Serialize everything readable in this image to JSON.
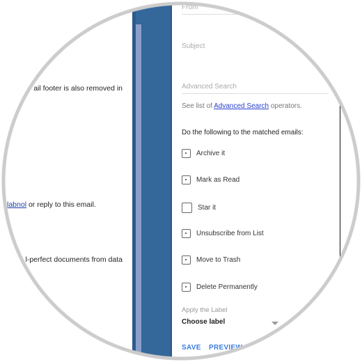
{
  "email": {
    "line1": "ail footer is also removed in",
    "line2_link": "labnol",
    "line2_rest": " or reply to this email.",
    "line3": "l-perfect documents from data"
  },
  "filter": {
    "from_placeholder": "From",
    "subject_placeholder": "Subject",
    "advanced_placeholder": "Advanced Search",
    "hint_prefix": "See list of ",
    "hint_link": "Advanced Search",
    "hint_suffix": " operators.",
    "actions_heading": "Do the following to the matched emails:",
    "options": [
      {
        "label": "Archive it",
        "checked": false
      },
      {
        "label": "Mark as Read",
        "checked": false
      },
      {
        "label": "Star it",
        "checked": false
      },
      {
        "label": "Unsubscribe from List",
        "checked": false
      },
      {
        "label": "Move to Trash",
        "checked": false
      },
      {
        "label": "Delete Permanently",
        "checked": false
      }
    ],
    "apply_label_caption": "Apply the Label",
    "label_select_value": "Choose label",
    "save_label": "SAVE",
    "preview_label": "PREVIEW"
  },
  "colors": {
    "sidebar": "#34679a",
    "accent": "#3b7ddd",
    "link": "#2a3fd0"
  }
}
